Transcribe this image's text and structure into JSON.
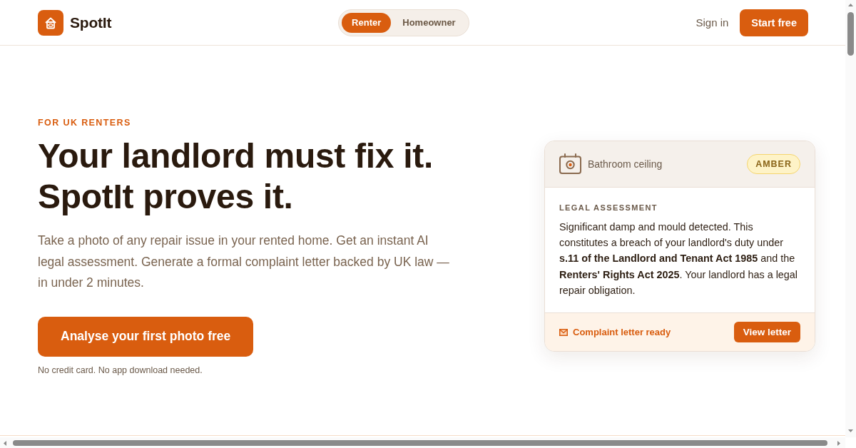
{
  "header": {
    "brand": "SpotIt",
    "audience_toggle": [
      {
        "label": "Renter",
        "selected": true
      },
      {
        "label": "Homeowner",
        "selected": false
      }
    ],
    "sign_in": "Sign in",
    "cta": "Start free"
  },
  "hero": {
    "eyebrow": "FOR UK RENTERS",
    "headline": [
      "Your landlord must fix it.",
      "SpotIt proves it."
    ],
    "description": "Take a photo of any repair issue in your rented home. Get an instant AI legal assessment. Generate a formal complaint letter backed by UK law — in under 2 minutes.",
    "cta": "Analyse your first photo free",
    "note": "No credit card. No app download needed."
  },
  "assessment_card": {
    "location": "Bathroom ceiling",
    "severity": "AMBER",
    "section_label": "LEGAL ASSESSMENT",
    "text": "Significant damp and mould detected. This constitutes a breach of your landlord's duty under **s.11 of the Landlord and Tenant Act 1985** and the **Renters' Rights Act 2025**. Your landlord has a legal repair obligation.",
    "status": "Complaint letter ready",
    "action": "View letter"
  }
}
